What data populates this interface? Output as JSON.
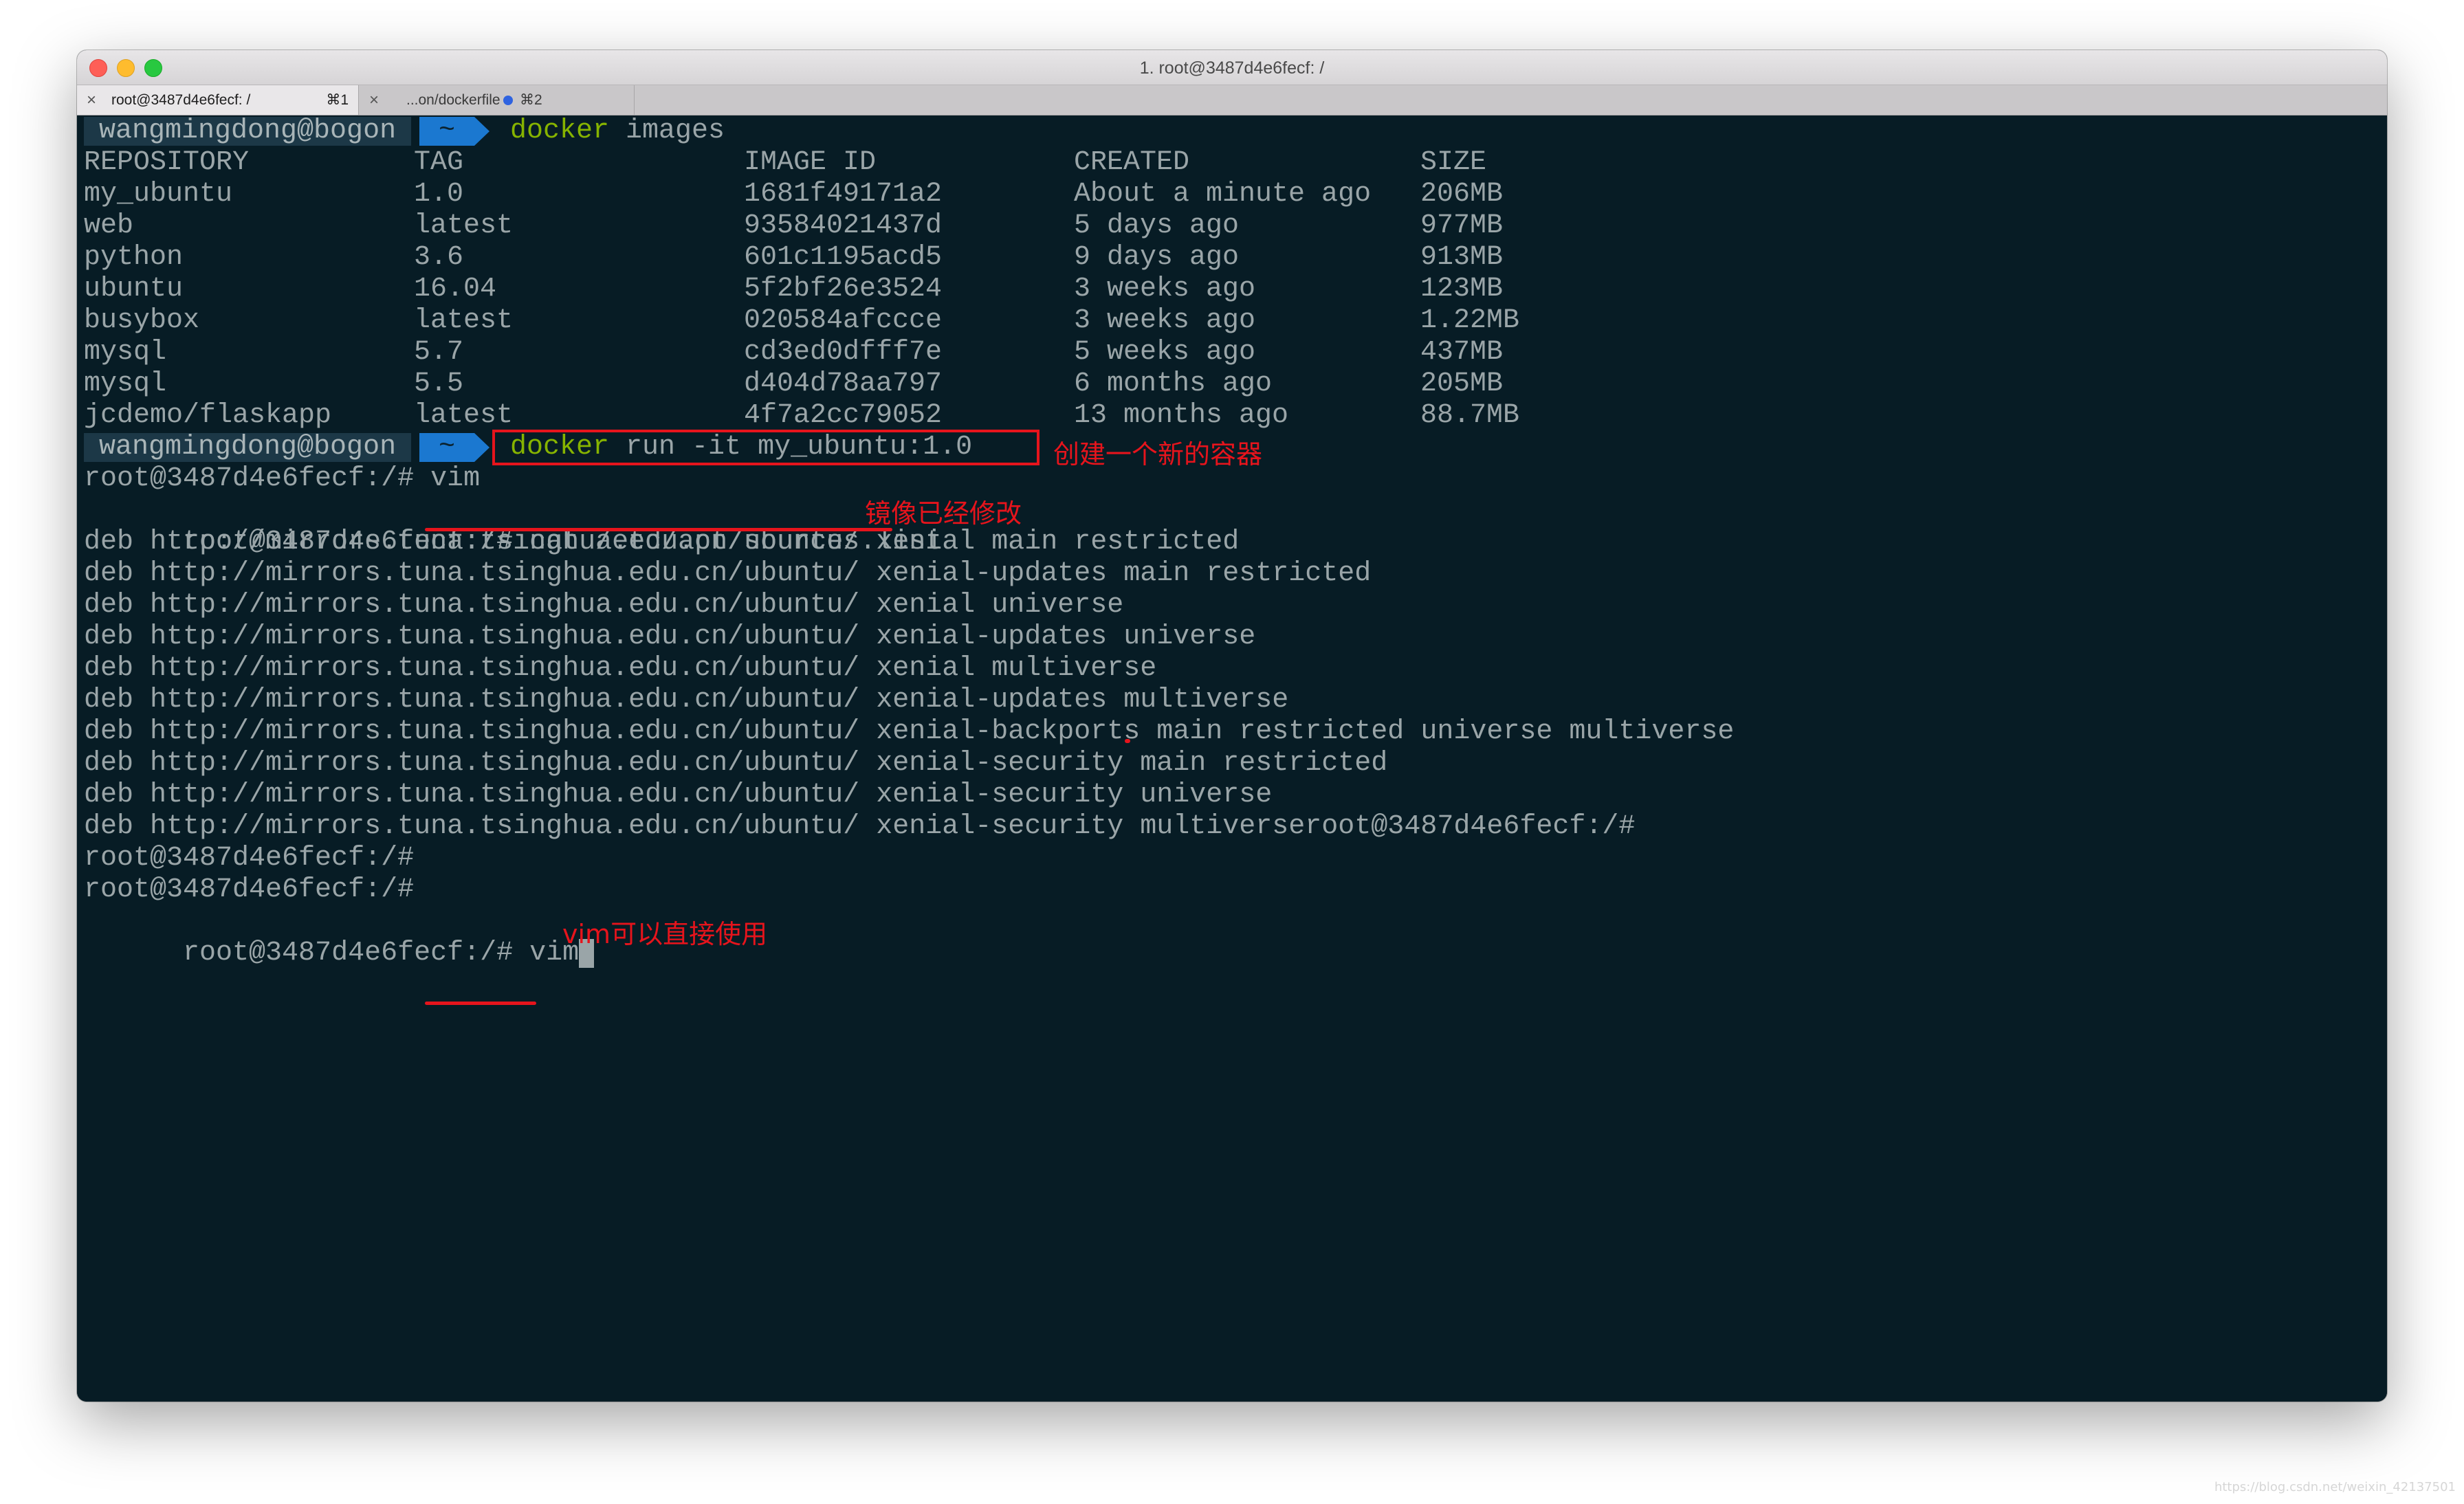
{
  "window": {
    "title": "1. root@3487d4e6fecf: /"
  },
  "tabs": [
    {
      "label": "root@3487d4e6fecf: /",
      "shortcut": "⌘1"
    },
    {
      "label": "...on/dockerfile",
      "shortcut": "⌘2"
    }
  ],
  "prompt": {
    "user": "wangmingdong@bogon",
    "dir": "~"
  },
  "commands": {
    "images_cmd": "docker",
    "images_arg": " images",
    "run_cmd": "docker",
    "run_arg": " run -it my_ubuntu:1.0"
  },
  "images_table": {
    "headers": [
      "REPOSITORY",
      "TAG",
      "IMAGE ID",
      "CREATED",
      "SIZE"
    ],
    "rows": [
      [
        "my_ubuntu",
        "1.0",
        "1681f49171a2",
        "About a minute ago",
        "206MB"
      ],
      [
        "web",
        "latest",
        "93584021437d",
        "5 days ago",
        "977MB"
      ],
      [
        "python",
        "3.6",
        "601c1195acd5",
        "9 days ago",
        "913MB"
      ],
      [
        "ubuntu",
        "16.04",
        "5f2bf26e3524",
        "3 weeks ago",
        "123MB"
      ],
      [
        "busybox",
        "latest",
        "020584afccce",
        "3 weeks ago",
        "1.22MB"
      ],
      [
        "mysql",
        "5.7",
        "cd3ed0dfff7e",
        "5 weeks ago",
        "437MB"
      ],
      [
        "mysql",
        "5.5",
        "d404d78aa797",
        "6 months ago",
        "205MB"
      ],
      [
        "jcdemo/flaskapp",
        "latest",
        "4f7a2cc79052",
        "13 months ago",
        "88.7MB"
      ]
    ]
  },
  "shell": {
    "line_vim": "root@3487d4e6fecf:/# vim",
    "line_cat_prompt": "root@3487d4e6fecf:/# ",
    "line_cat_cmd": "cat /etc/apt/sources.list",
    "sources": [
      "deb http://mirrors.tuna.tsinghua.edu.cn/ubuntu/ xenial main restricted",
      "deb http://mirrors.tuna.tsinghua.edu.cn/ubuntu/ xenial-updates main restricted",
      "deb http://mirrors.tuna.tsinghua.edu.cn/ubuntu/ xenial universe",
      "deb http://mirrors.tuna.tsinghua.edu.cn/ubuntu/ xenial-updates universe",
      "deb http://mirrors.tuna.tsinghua.edu.cn/ubuntu/ xenial multiverse",
      "deb http://mirrors.tuna.tsinghua.edu.cn/ubuntu/ xenial-updates multiverse",
      "deb http://mirrors.tuna.tsinghua.edu.cn/ubuntu/ xenial-backports main restricted universe multiverse",
      "deb http://mirrors.tuna.tsinghua.edu.cn/ubuntu/ xenial-security main restricted",
      "deb http://mirrors.tuna.tsinghua.edu.cn/ubuntu/ xenial-security universe",
      "deb http://mirrors.tuna.tsinghua.edu.cn/ubuntu/ xenial-security multiverseroot@3487d4e6fecf:/#"
    ],
    "empty_prompt_1": "root@3487d4e6fecf:/#",
    "empty_prompt_2": "root@3487d4e6fecf:/#",
    "last_prompt": "root@3487d4e6fecf:/# ",
    "last_cmd": "vim"
  },
  "annotations": {
    "new_container": "创建一个新的容器",
    "mirror_modified": "镜像已经修改",
    "vim_usable": "vim可以直接使用"
  },
  "watermark": "https://blog.csdn.net/weixin_42137501",
  "colors": {
    "terminal_bg": "#071c25",
    "terminal_fg": "#9aa5a8",
    "command_green": "#86b300",
    "prompt_dir_bg": "#1b78d0",
    "annotation_red": "#e6141c"
  }
}
